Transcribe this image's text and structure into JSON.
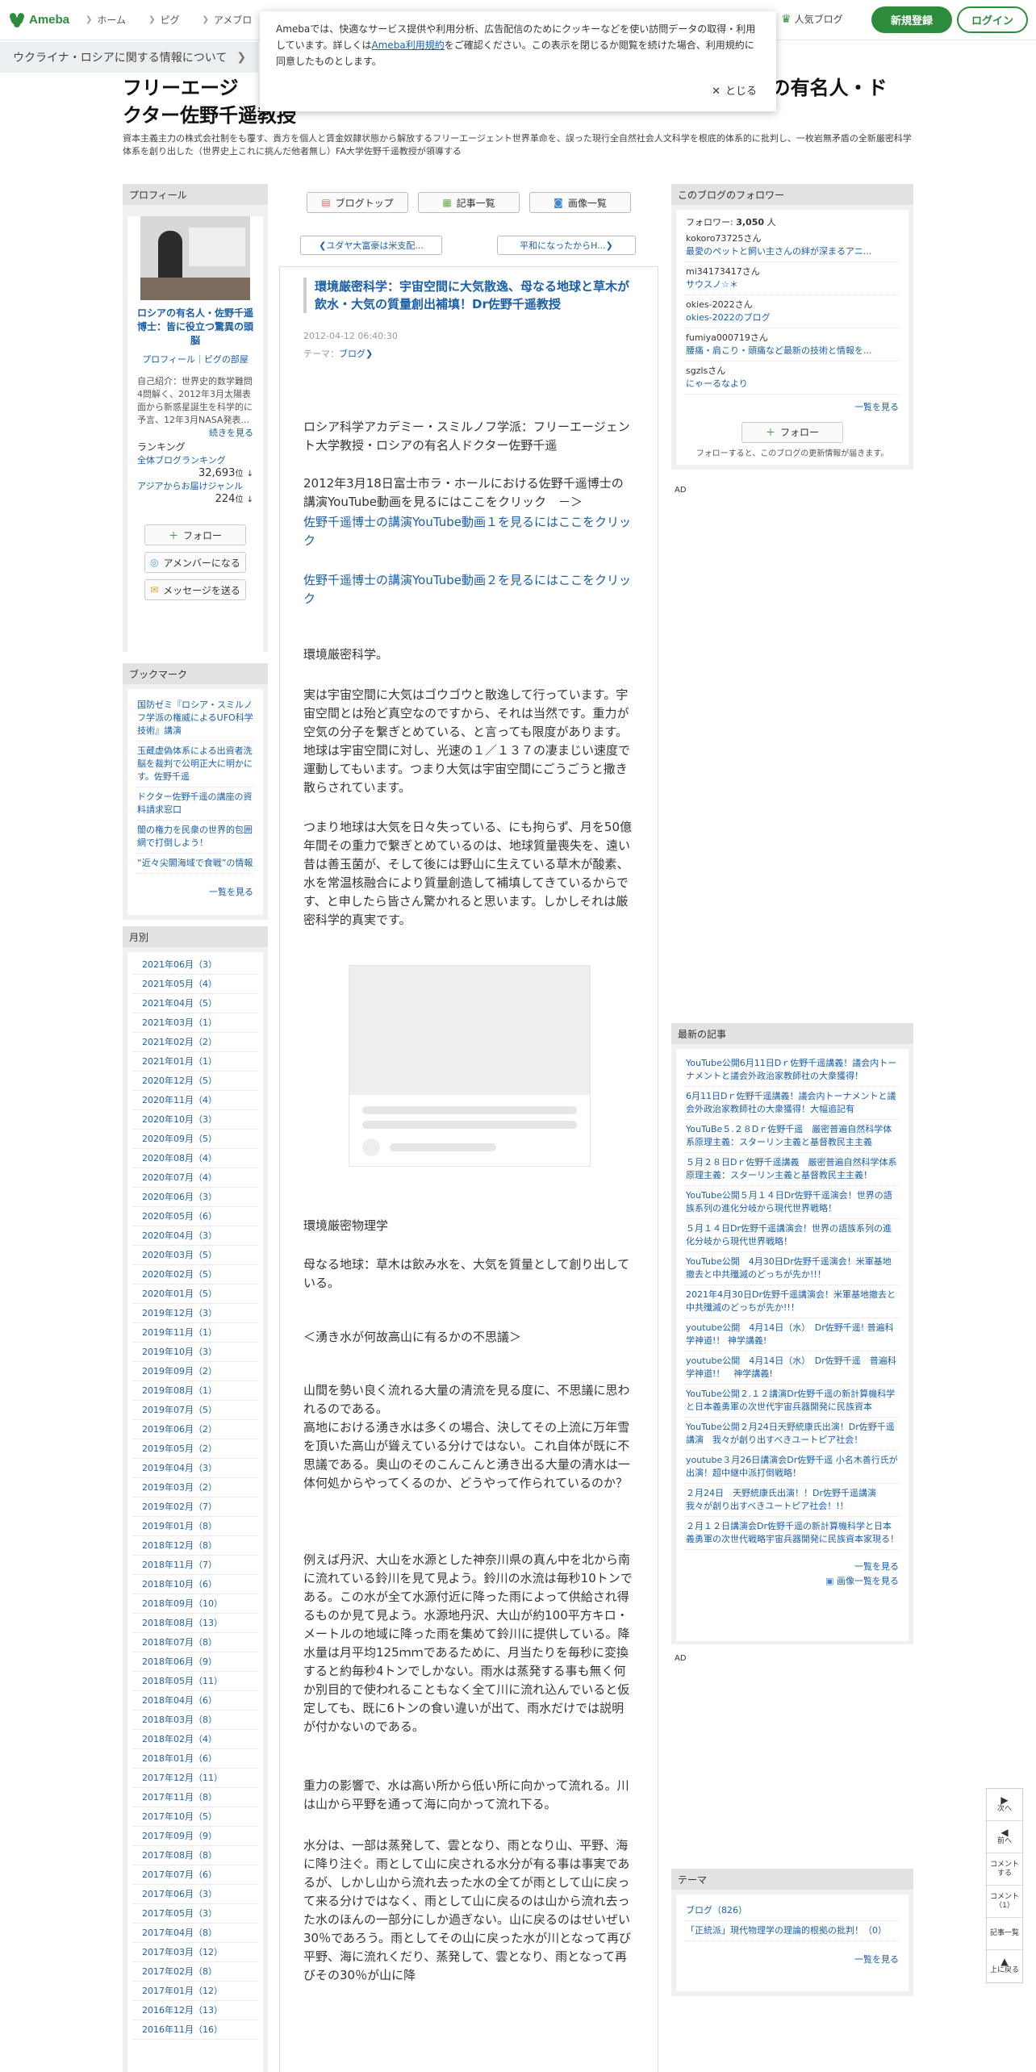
{
  "header": {
    "logo": "Ameba",
    "nav": [
      "ホーム",
      "ピグ",
      "アメブロ"
    ],
    "popular": "人気ブログ",
    "register": "新規登録",
    "login": "ログイン"
  },
  "banner": {
    "ukraine": "ウクライナ・ロシアに関する情報について"
  },
  "cookie": {
    "text_before": "Amebaでは、快適なサービス提供や利用分析、広告配信のためにクッキーなどを使い訪問データの取得・利用しています。詳しくは",
    "link": "Ameba利用規約",
    "text_after": "をご確認ください。この表示を閉じるか閲覧を続けた場合、利用規約に同意したものとします。",
    "close": "とじる"
  },
  "blog": {
    "title_line1": "フリーエージ",
    "title_line1b": "アの有名人・ド",
    "title_line2": "クター佐野千遥教授",
    "description": "資本主義主力の株式会社制をも覆す、貴方を個人と賃金奴隷状態から解放するフリーエージェント世界革命を、誤った現行全自然社会人文科学を根底的体系的に批判し、一枚岩無矛盾の全新厳密科学体系を創り出した（世界史上これに挑んだ他者無し）FA大学佐野千遥教授が領導する"
  },
  "profile": {
    "head": "プロフィール",
    "name": "ロシアの有名人・佐野千遥博士：皆に役立つ驚異の頭脳",
    "links": "プロフィール｜ピグの部屋",
    "intro": "自己紹介：世界史的数学難問4問解く、2012年3月太陽表面から新惑星誕生を科学的に予言、12年3月NASA発表...",
    "intro_more": "続きを見る",
    "rank_label": "ランキング",
    "rank1_label": "全体ブログランキング",
    "rank1_val": "32,693",
    "rank2_label": "アジアからお届けジャンル",
    "rank2_val": "224",
    "rank_unit": "位",
    "follow": "フォロー",
    "amember": "アメンバーになる",
    "message": "メッセージを送る"
  },
  "bookmark": {
    "head": "ブックマーク",
    "items": [
      "国防ゼミ『ロシア・スミルノフ学派の権威によるUFO科学技術』講演",
      "玉蔵虚偽体系による出資者洗脳を裁判で公明正大に明かにす。佐野千遥",
      "ドクター佐野千遥の講座の資料請求窓口",
      "闇の権力を民衆の世界的包囲網で打倒しよう！",
      "“近々尖閣海域で食戦”の情報"
    ],
    "more": "一覧を見る"
  },
  "monthly": {
    "head": "月別",
    "items": [
      "2021年06月（3）",
      "2021年05月（4）",
      "2021年04月（5）",
      "2021年03月（1）",
      "2021年02月（2）",
      "2021年01月（1）",
      "2020年12月（5）",
      "2020年11月（4）",
      "2020年10月（3）",
      "2020年09月（5）",
      "2020年08月（4）",
      "2020年07月（4）",
      "2020年06月（3）",
      "2020年05月（6）",
      "2020年04月（3）",
      "2020年03月（5）",
      "2020年02月（5）",
      "2020年01月（5）",
      "2019年12月（3）",
      "2019年11月（1）",
      "2019年10月（3）",
      "2019年09月（2）",
      "2019年08月（1）",
      "2019年07月（5）",
      "2019年06月（2）",
      "2019年05月（2）",
      "2019年04月（3）",
      "2019年03月（2）",
      "2019年02月（7）",
      "2019年01月（8）",
      "2018年12月（8）",
      "2018年11月（7）",
      "2018年10月（6）",
      "2018年09月（10）",
      "2018年08月（13）",
      "2018年07月（8）",
      "2018年06月（9）",
      "2018年05月（11）",
      "2018年04月（6）",
      "2018年03月（8）",
      "2018年02月（4）",
      "2018年01月（6）",
      "2017年12月（11）",
      "2017年11月（8）",
      "2017年10月（5）",
      "2017年09月（9）",
      "2017年08月（8）",
      "2017年07月（6）",
      "2017年06月（3）",
      "2017年05月（3）",
      "2017年04月（8）",
      "2017年03月（12）",
      "2017年02月（8）",
      "2017年01月（12）",
      "2016年12月（13）",
      "2016年11月（16）"
    ]
  },
  "tabs": {
    "top": "ブログトップ",
    "list": "記事一覧",
    "images": "画像一覧"
  },
  "pager": {
    "prev": "ユダヤ大富豪は米支配...",
    "next": "平和になったからH..."
  },
  "entry": {
    "title": "環境厳密科学：宇宙空間に大気散逸、母なる地球と草木が飲水・大気の質量創出補填！Dr佐野千遥教授",
    "date": "2012-04-12 06:40:30",
    "theme_label": "テーマ：",
    "theme": "ブログ",
    "p1": "ロシア科学アカデミー・スミルノフ学派：フリーエージェント大学教授・ロシアの有名人ドクター佐野千遥",
    "p2": "2012年3月18日富士市ラ・ホールにおける佐野千遥博士の講演YouTube動画を見るにはここをクリック　－＞",
    "link1": "佐野千遥博士の講演YouTube動画１を見るにはここをクリック",
    "link2": "佐野千遥博士の講演YouTube動画２を見るにはここをクリック",
    "p3": "環境厳密科学。",
    "p4": "実は宇宙空間に大気はゴウゴウと散逸して行っています。宇宙空間とは殆ど真空なのですから、それは当然です。重力が空気の分子を繋ぎとめている、と言っても限度があります。地球は宇宙空間に対し、光速の１／１３７の凄まじい速度で運動してもいます。つまり大気は宇宙空間にごうごうと撒き散らされています。",
    "p5": "つまり地球は大気を日々失っている、にも拘らず、月を50億年間その重力で繋ぎとめているのは、地球質量喪失を、遠い昔は善玉菌が、そして後には野山に生えている草木が酸素、水を常温核融合により質量創造して補填してきているからです、と申したら皆さん驚かれると思います。しかしそれは厳密科学的真実です。",
    "p6": "環境厳密物理学",
    "p7": "母なる地球：草木は飲み水を、大気を質量として創り出している。",
    "p8": "＜湧き水が何故高山に有るかの不思議＞",
    "p9": "山間を勢い良く流れる大量の清流を見る度に、不思議に思われるのである。\n高地における湧き水は多くの場合、決してその上流に万年雪を頂いた高山が聳えている分けではない。これ自体が既に不思議である。奥山のそのこんこんと湧き出る大量の清水は一体何処からやってくるのか、どうやって作られているのか？",
    "p10": "例えば丹沢、大山を水源とした神奈川県の真ん中を北から南に流れている鈴川を見て見よう。鈴川の水流は毎秒10トンである。この水が全て水源付近に降った雨によって供給され得るものか見て見よう。水源地丹沢、大山が約100平方キロ・メートルの地域に降った雨を集めて鈴川に提供している。降水量は月平均125ｍｍであるために、月当たりを毎秒に変換すると約毎秒4トンでしかない。雨水は蒸発する事も無く何か別目的で使われることもなく全て川に流れ込んでいると仮定しても、既に6トンの食い違いが出て、雨水だけでは説明が付かないのである。",
    "p11": "重力の影響で、水は高い所から低い所に向かって流れる。川は山から平野を通って海に向かって流れ下る。",
    "p12": "水分は、一部は蒸発して、雲となり、雨となり山、平野、海に降り注ぐ。雨として山に戻される水分が有る事は事実であるが、しかし山から流れ去った水の全てが雨として山に戻って来る分けではなく、雨として山に戻るのは山から流れ去った水のほんの一部分にしか過ぎない。山に戻るのはせいぜい30％であろう。雨としてその山に戻った水が川となって再び平野、海に流れくだり、蒸発して、雲となり、雨となって再びその30％が山に降"
  },
  "followers": {
    "head": "このブログのフォロワー",
    "count_label": "フォロワー:",
    "count": "3,050",
    "count_unit": "人",
    "items": [
      {
        "user": "kokoro73725さん",
        "blog": "最愛のペットと飼い主さんの絆が深まるアニ..."
      },
      {
        "user": "mi34173417さん",
        "blog": "サウスノ☆＊"
      },
      {
        "user": "okies-2022さん",
        "blog": "okies-2022のブログ"
      },
      {
        "user": "fumiya000719さん",
        "blog": "腰痛・肩こり・頭痛など最新の技術と情報を..."
      },
      {
        "user": "sgzlsさん",
        "blog": "にゃーるなより"
      }
    ],
    "more": "一覧を見る",
    "follow": "フォロー",
    "note": "フォローすると、このブログの更新情報が届きます。"
  },
  "ad_label": "AD",
  "recent": {
    "head": "最新の記事",
    "items": [
      "YouTube公開6月11日Dｒ佐野千遥講義！議会内トーナメントと議会外政治家教師社の大衆獲得！",
      "6月11日Dｒ佐野千遥講義！議会内トーナメントと議会外政治家教師社の大衆獲得！大幅追記有",
      "YouTuBe５.２８Dｒ佐野千遥　厳密普遍自然科学体系原理主義：スターリン主義と基督教民主主義",
      "５月２８日Dｒ佐野千遥講義　厳密普遍自然科学体系原理主義：スターリン主義と基督教民主主義！",
      "YouTube公開５月１４日Dr佐野千遥演会！世界の語族系列の進化分岐から現代世界戦略！",
      "５月１４日Dr佐野千遥講演会！世界の語族系列の進化分岐から現代世界戦略！",
      "YouTube公開　4月30日Dr佐野千遥演会！米軍基地撤去と中共殲滅のどっちが先か!!！",
      "2021年4月30日Dr佐野千遥講演会！米軍基地撤去と中共殲滅のどっちが先か!!！",
      "youtube公開　4月14日（水）　Dr佐野千遥! 普遍科学神道!！ 神学講義!",
      "youtube公開　4月14日（水）　Dr佐野千遥　普遍科学神道!！　神学講義!",
      "YouTube公開２.１２講演Dr佐野千遥の新計算機科学と日本義勇軍の次世代宇宙兵器開発に民族資本",
      "YouTube公開２月24日天野統康氏出演！Dr佐野千遥講演　我々が創り出すべきユートピア社会！",
      "youtube３月26日講演会Dr佐野千遥 小名木善行氏が出演！超中継中派打倒戦略！",
      "２月24日　天野統康氏出演！！Dr佐野千遥講演　我々が創り出すべきユートピア社会！!！",
      "２月１２日講演会Dr佐野千遥の新計算機科学と日本義勇軍の次世代戦略宇宙兵器開発に民族資本家現る！"
    ],
    "more": "一覧を見る",
    "images": "画像一覧を見る"
  },
  "theme_box": {
    "head": "テーマ",
    "items": [
      "ブログ（826）",
      "「正統派」現代物理学の理論的根拠の批判！（0）"
    ],
    "more": "一覧を見る"
  },
  "float_nav": {
    "next": "次へ",
    "prev": "前へ",
    "comment": "コメントする",
    "comments": "コメント（1）",
    "list": "記事一覧",
    "top": "上に戻る"
  }
}
